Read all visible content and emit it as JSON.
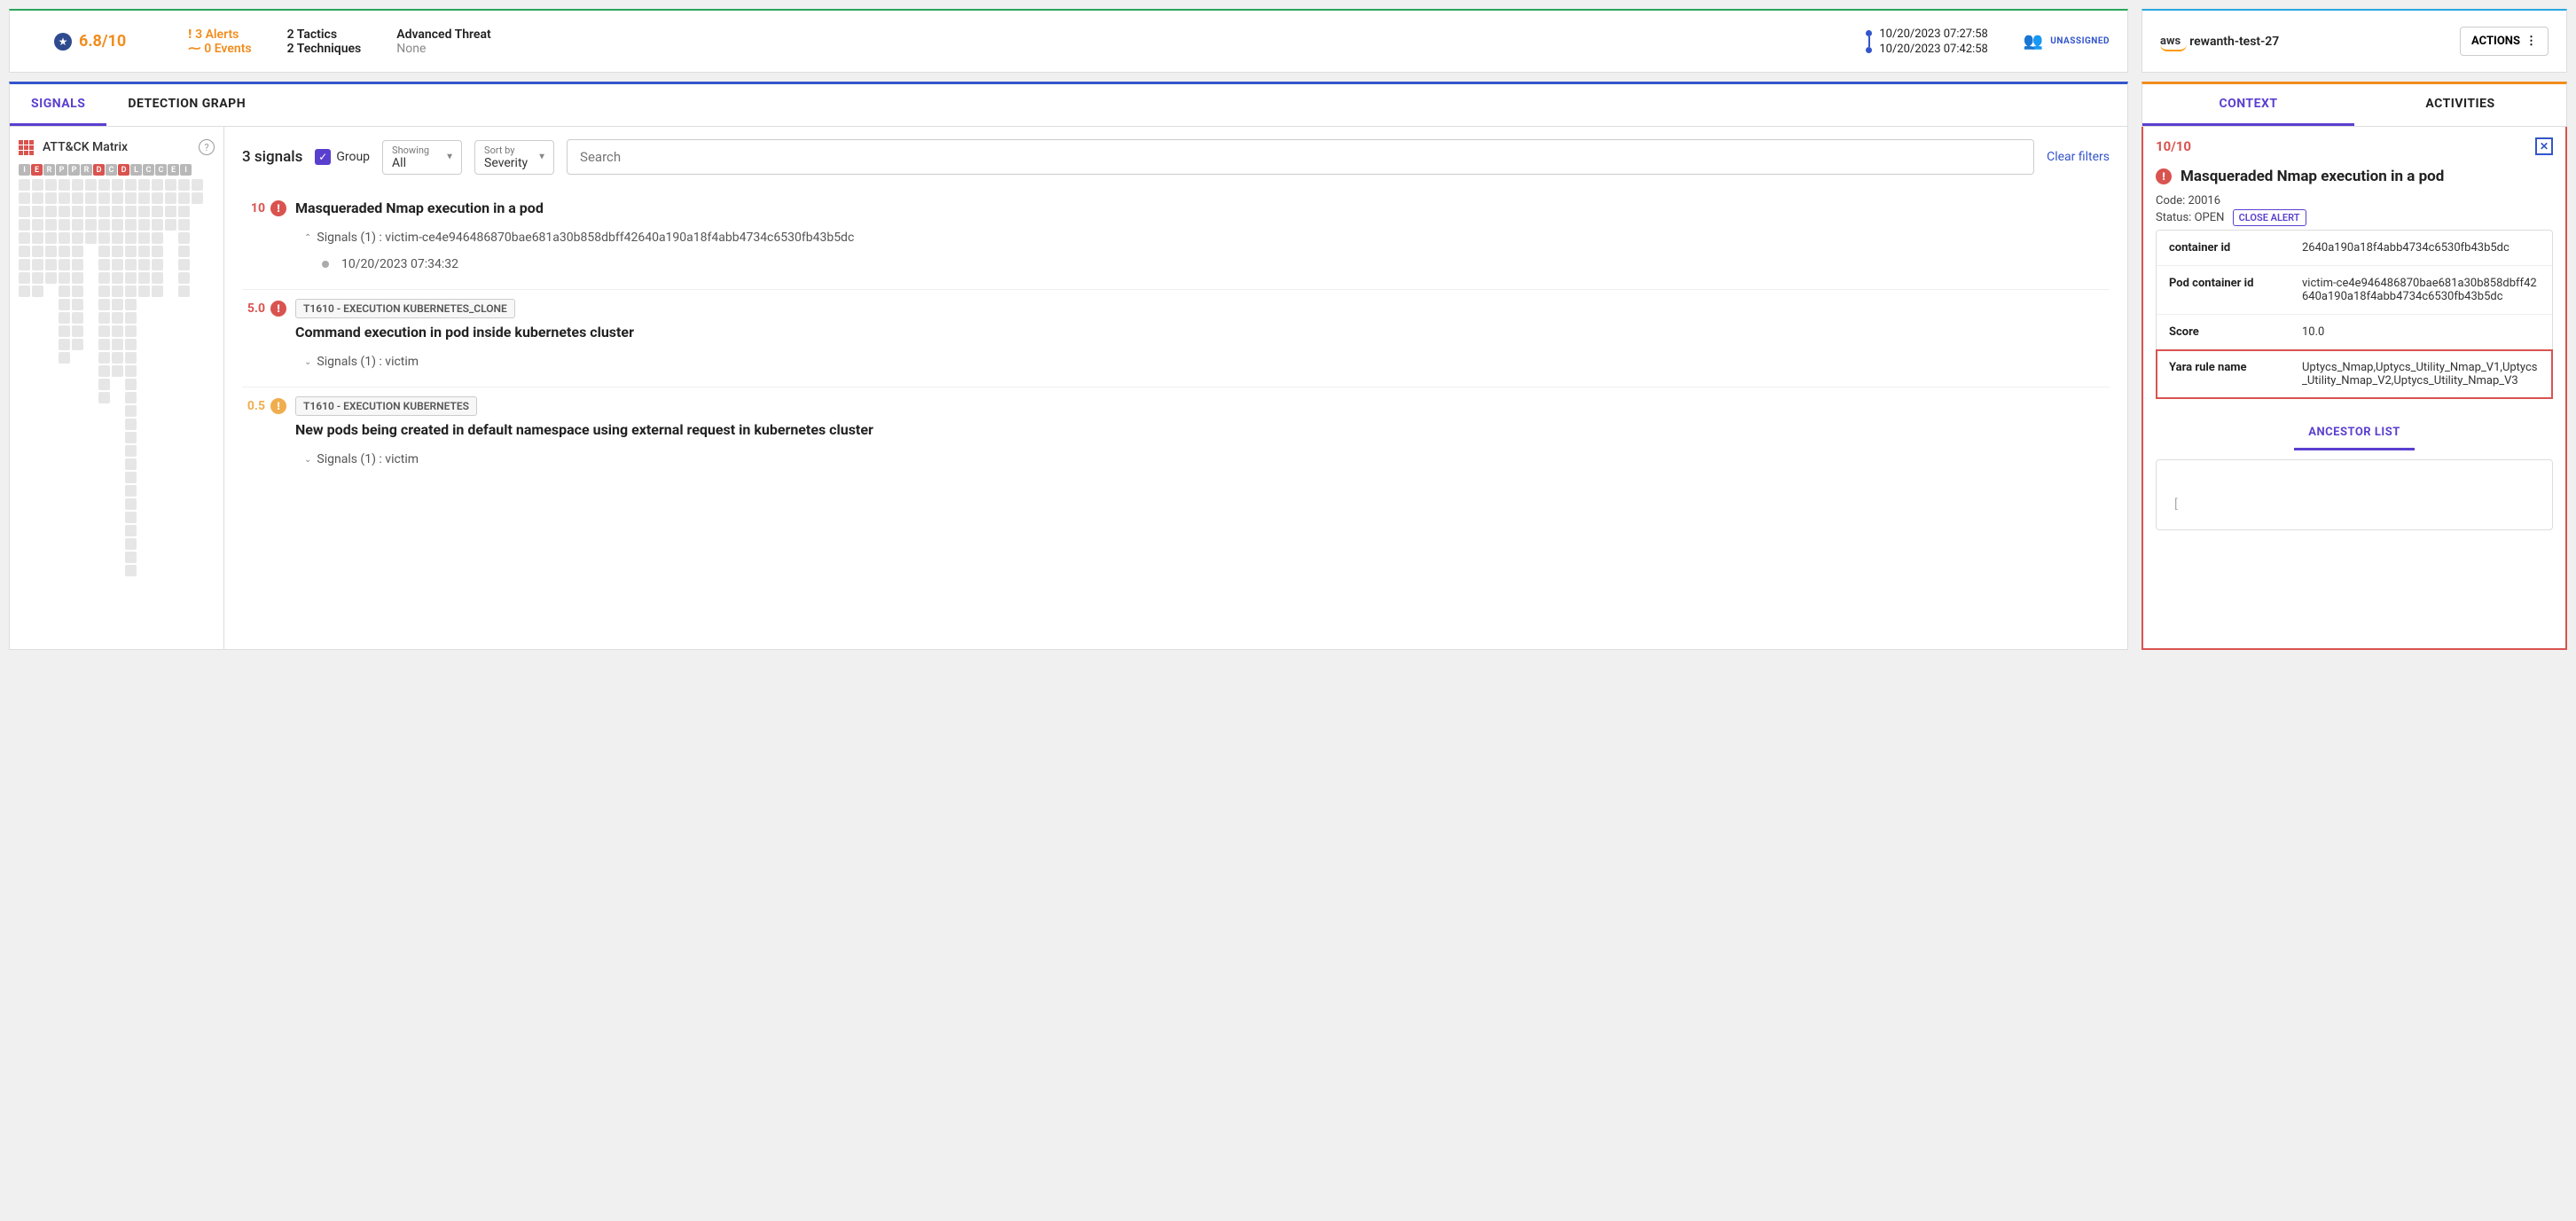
{
  "header": {
    "score": "6.8/10",
    "alerts": "3 Alerts",
    "events": "0 Events",
    "tactics": "2 Tactics",
    "techniques": "2 Techniques",
    "threat_title": "Advanced Threat",
    "threat_sub": "None",
    "time_start": "10/20/2023 07:27:58",
    "time_end": "10/20/2023 07:42:58",
    "assignment": "UNASSIGNED"
  },
  "account": {
    "provider": "aws",
    "name": "rewanth-test-27",
    "actions_label": "ACTIONS"
  },
  "tabs": {
    "signals": "SIGNALS",
    "detection_graph": "DETECTION GRAPH"
  },
  "matrix": {
    "title": "ATT&CK Matrix",
    "letters": [
      "I",
      "E",
      "R",
      "P",
      "P",
      "R",
      "D",
      "C",
      "D",
      "L",
      "C",
      "C",
      "E",
      "I"
    ],
    "hot_indices": [
      1,
      6,
      8
    ]
  },
  "toolbar": {
    "count": "3 signals",
    "group_label": "Group",
    "showing_label": "Showing",
    "showing_value": "All",
    "sortby_label": "Sort by",
    "sortby_value": "Severity",
    "search_placeholder": "Search",
    "clear_filters": "Clear filters"
  },
  "signals": [
    {
      "severity": "10",
      "sev_color": "red",
      "technique": "",
      "title": "Masqueraded Nmap execution in a pod",
      "expanded": true,
      "sub": "Signals (1) : victim-ce4e946486870bae681a30b858dbff42640a190a18f4abb4734c6530fb43b5dc",
      "timeline": "10/20/2023 07:34:32"
    },
    {
      "severity": "5.0",
      "sev_color": "red",
      "technique": "T1610 - EXECUTION KUBERNETES_CLONE",
      "title": "Command execution in pod inside kubernetes cluster",
      "expanded": false,
      "sub": "Signals (1) : victim"
    },
    {
      "severity": "0.5",
      "sev_color": "yellow",
      "technique": "T1610 - EXECUTION KUBERNETES",
      "title": "New pods being created in default namespace using external request in kubernetes cluster",
      "expanded": false,
      "sub": "Signals (1) : victim"
    }
  ],
  "right_tabs": {
    "context": "CONTEXT",
    "activities": "ACTIVITIES"
  },
  "detail": {
    "score": "10/10",
    "title": "Masqueraded Nmap execution in a pod",
    "code_label": "Code:",
    "code_value": "20016",
    "status_label": "Status:",
    "status_value": "OPEN",
    "close_alert": "CLOSE ALERT",
    "rows": [
      {
        "key": "container id",
        "value": "2640a190a18f4abb4734c6530fb43b5dc"
      },
      {
        "key": "Pod container id",
        "value": "victim-ce4e946486870bae681a30b858dbff42640a190a18f4abb4734c6530fb43b5dc"
      },
      {
        "key": "Score",
        "value": "10.0"
      },
      {
        "key": "Yara rule name",
        "value": "Uptycs_Nmap,Uptycs_Utility_Nmap_V1,Uptycs_Utility_Nmap_V2,Uptycs_Utility_Nmap_V3",
        "highlight": true
      }
    ],
    "ancestor_tab": "ANCESTOR LIST",
    "ancestor_body": "["
  }
}
